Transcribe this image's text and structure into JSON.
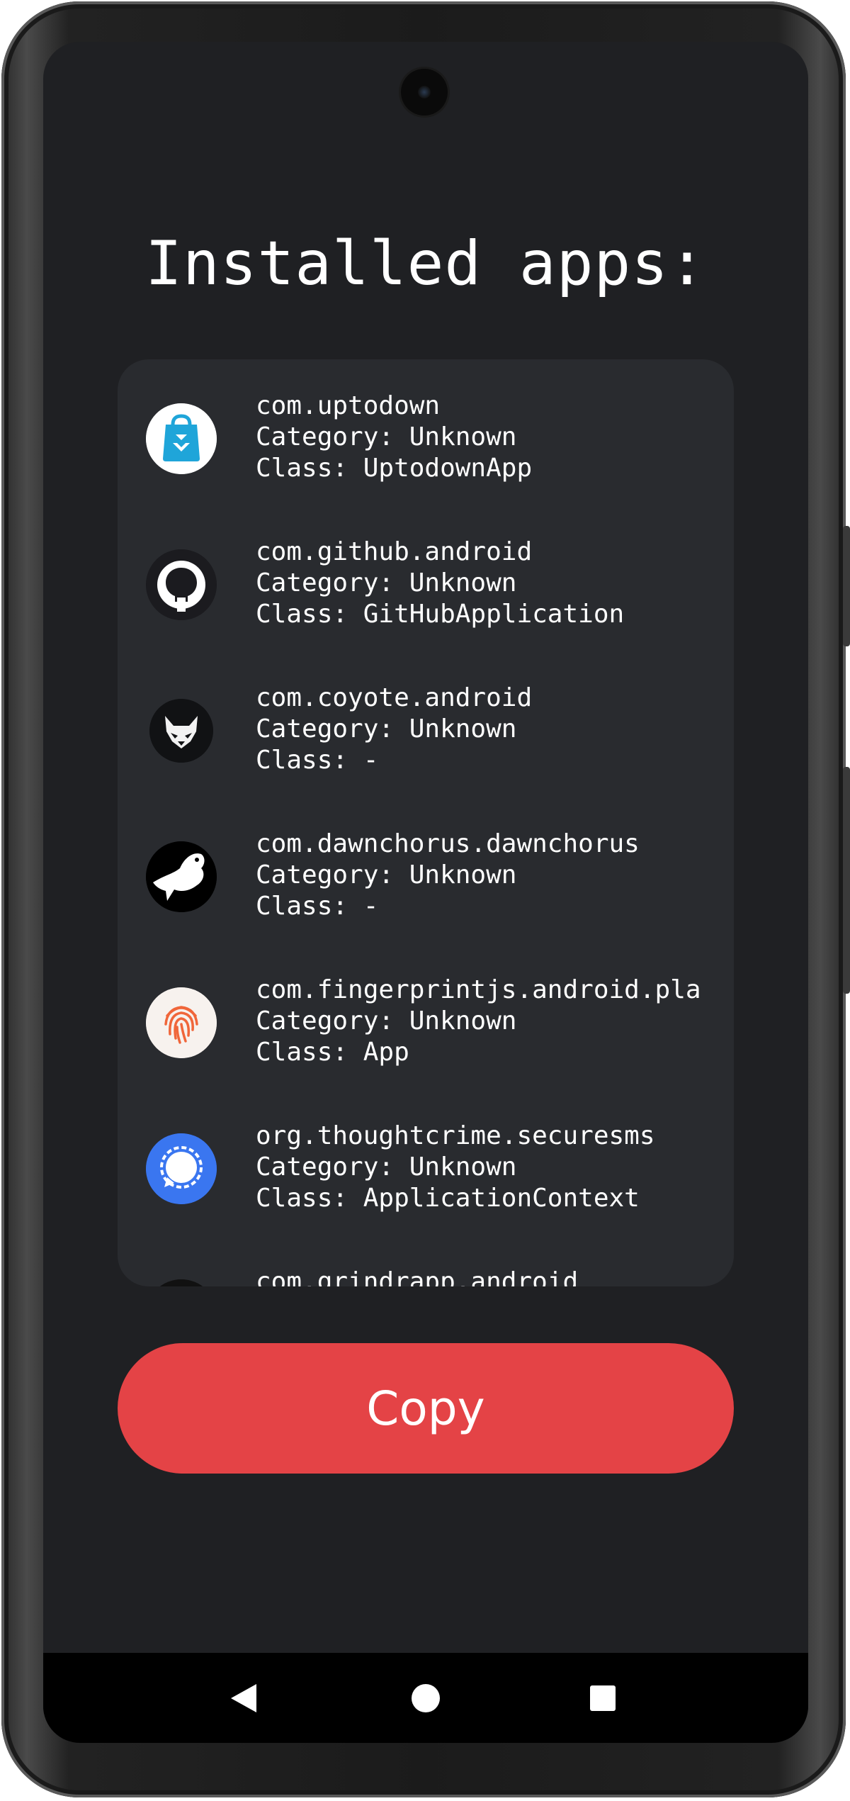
{
  "screen": {
    "title": "Installed apps:"
  },
  "apps": [
    {
      "package": "com.uptodown",
      "category": "Category: Unknown",
      "class": "Class: UptodownApp",
      "icon": "uptodown-icon",
      "icon_bg": "#ffffff"
    },
    {
      "package": "com.github.android",
      "category": "Category: Unknown",
      "class": "Class: GitHubApplication",
      "icon": "github-icon",
      "icon_bg": "#1b1b1f"
    },
    {
      "package": "com.coyote.android",
      "category": "Category: Unknown",
      "class": "Class: -",
      "icon": "coyote-icon",
      "icon_bg": "#111214"
    },
    {
      "package": "com.dawnchorus.dawnchorus",
      "category": "Category: Unknown",
      "class": "Class: -",
      "icon": "dawnchorus-bird-icon",
      "icon_bg": "#000000"
    },
    {
      "package": "com.fingerprintjs.android.pla",
      "category": "Category: Unknown",
      "class": "Class: App",
      "icon": "fingerprint-icon",
      "icon_bg": "#f7f2ee"
    },
    {
      "package": "org.thoughtcrime.securesms",
      "category": "Category: Unknown",
      "class": "Class: ApplicationContext",
      "icon": "signal-icon",
      "icon_bg": "#3a76f0"
    },
    {
      "package": "com.grindrapp.android",
      "category": "",
      "class": "",
      "icon": "grindr-icon",
      "icon_bg": "#111111"
    }
  ],
  "actions": {
    "copy_label": "Copy"
  },
  "navigation": {
    "back": "back-icon",
    "home": "home-icon",
    "recents": "recents-icon"
  },
  "colors": {
    "screen_bg": "#1f2023",
    "card_bg": "#292b2f",
    "copy_button": "#e44346",
    "text": "#ffffff"
  }
}
